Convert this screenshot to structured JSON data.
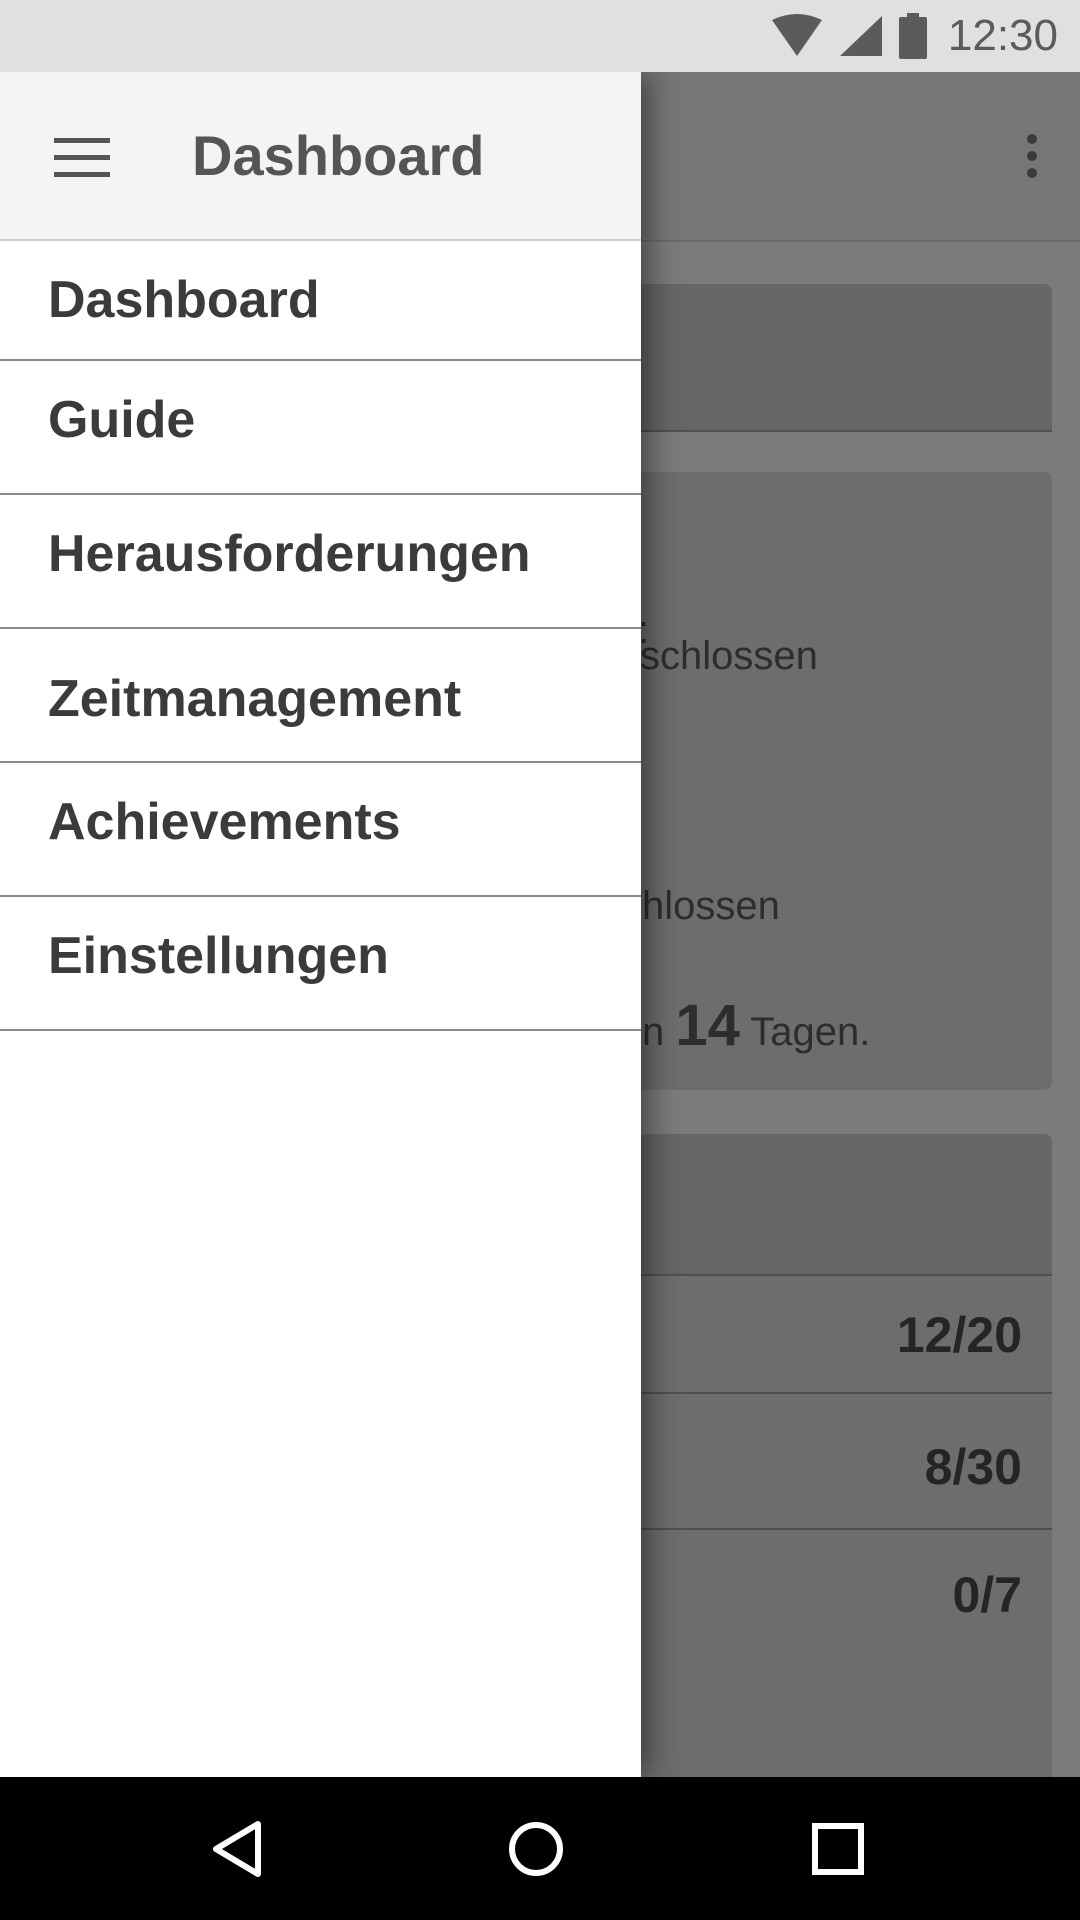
{
  "status_bar": {
    "time": "12:30",
    "icons": [
      "wifi-icon",
      "signal-icon",
      "battery-icon"
    ]
  },
  "drawer": {
    "header_title": "Dashboard",
    "items": [
      {
        "label": "Dashboard"
      },
      {
        "label": "Guide"
      },
      {
        "label": "Herausforderungen"
      },
      {
        "label": "Zeitmanagement"
      },
      {
        "label": "Achievements"
      },
      {
        "label": "Einstellungen"
      }
    ]
  },
  "background": {
    "overview": {
      "line1": ":",
      "line2": "schlossen",
      "line3": "hlossen",
      "line4_prefix": "n",
      "line4_number": "14",
      "line4_suffix": "Tagen."
    },
    "progress_rows": [
      {
        "value": "12/20"
      },
      {
        "value": "8/30"
      },
      {
        "value": "0/7"
      }
    ]
  },
  "nav_bar": {
    "buttons": [
      "back-icon",
      "home-icon",
      "recents-icon"
    ]
  },
  "colors": {
    "drawer_bg": "#ffffff",
    "drawer_header_bg": "#f4f4f4",
    "scrim_bg": "#7b7b7b",
    "status_bar_bg": "#e0e0e0",
    "nav_bar_bg": "#000000"
  }
}
